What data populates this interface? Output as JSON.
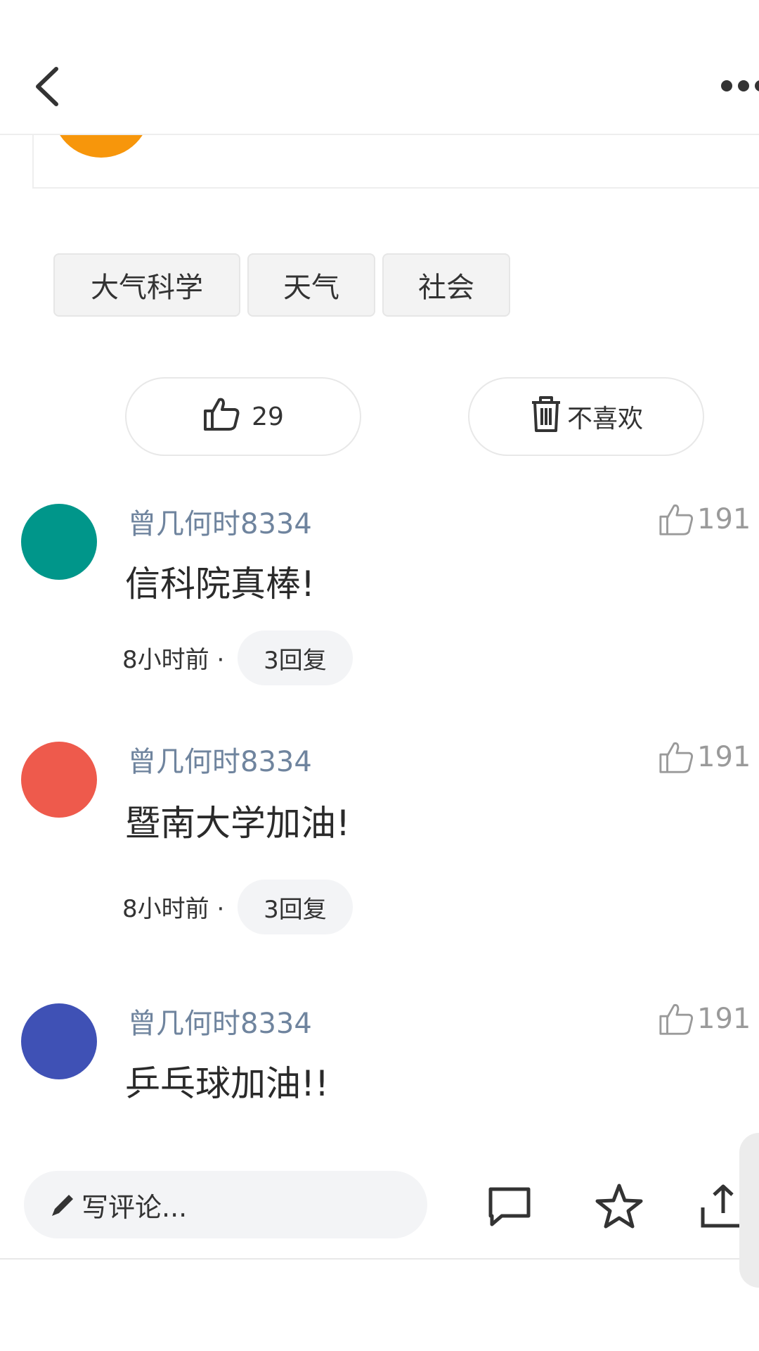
{
  "tags": [
    "大气科学",
    "天气",
    "社会"
  ],
  "reactions": {
    "like_count": "29",
    "dislike_label": "不喜欢"
  },
  "comments": [
    {
      "user": "曾几何时8334",
      "text": "信科院真棒!",
      "likes": "191",
      "time": "8小时前 ·",
      "replies": "3回复",
      "avatar_color": "#00968a"
    },
    {
      "user": "曾几何时8334",
      "text": "暨南大学加油!",
      "likes": "191",
      "time": "8小时前 ·",
      "replies": "3回复",
      "avatar_color": "#ee5a4c"
    },
    {
      "user": "曾几何时8334",
      "text": "乒乓球加油!!",
      "likes": "191",
      "avatar_color": "#3f51b5"
    }
  ],
  "bottom_bar": {
    "input_placeholder": "写评论..."
  },
  "icons": [
    "back-icon",
    "more-icon",
    "thumbs-up-icon",
    "trash-icon",
    "pencil-icon",
    "comment-icon",
    "star-icon",
    "share-icon"
  ]
}
